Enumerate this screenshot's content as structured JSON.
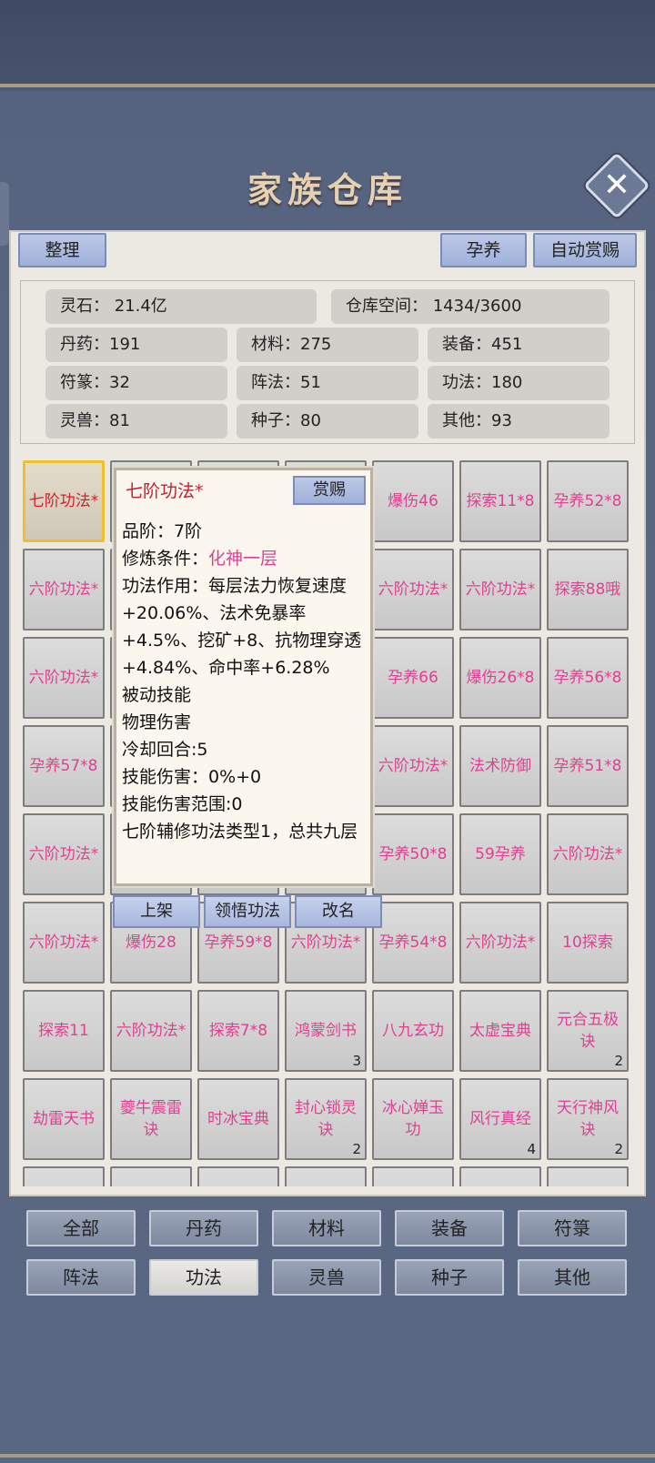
{
  "title": "家族仓库",
  "toolbar": {
    "sort": "整理",
    "nurture": "孕养",
    "auto_reward": "自动赏赐"
  },
  "stats": {
    "spirit_stone": "灵石：  21.4亿",
    "capacity": "仓库空间：   1434/3600",
    "pills": "丹药：191",
    "materials": "材料：275",
    "equipment": "装备：451",
    "talismans": "符篆：32",
    "formations": "阵法：51",
    "techniques": "功法：180",
    "beasts": "灵兽：81",
    "seeds": "种子：80",
    "others": "其他：93"
  },
  "grid": [
    {
      "label": "七阶功法*",
      "selected": true
    },
    {
      "label": ""
    },
    {
      "label": ""
    },
    {
      "label": ""
    },
    {
      "label": "爆伤46"
    },
    {
      "label": "探索11*8"
    },
    {
      "label": "孕养52*8"
    },
    {
      "label": "六阶功法*"
    },
    {
      "label": ""
    },
    {
      "label": ""
    },
    {
      "label": ""
    },
    {
      "label": "六阶功法*"
    },
    {
      "label": "六阶功法*"
    },
    {
      "label": "探索88哦"
    },
    {
      "label": "六阶功法*"
    },
    {
      "label": ""
    },
    {
      "label": ""
    },
    {
      "label": ""
    },
    {
      "label": "孕养66"
    },
    {
      "label": "爆伤26*8"
    },
    {
      "label": "孕养56*8"
    },
    {
      "label": "孕养57*8"
    },
    {
      "label": ""
    },
    {
      "label": ""
    },
    {
      "label": ""
    },
    {
      "label": "六阶功法*"
    },
    {
      "label": "法术防御"
    },
    {
      "label": "孕养51*8"
    },
    {
      "label": "六阶功法*"
    },
    {
      "label": ""
    },
    {
      "label": ""
    },
    {
      "label": ""
    },
    {
      "label": "孕养50*8"
    },
    {
      "label": "59孕养"
    },
    {
      "label": "六阶功法*"
    },
    {
      "label": "六阶功法*"
    },
    {
      "label": "爆伤28"
    },
    {
      "label": "孕养59*8"
    },
    {
      "label": "六阶功法*"
    },
    {
      "label": "孕养54*8"
    },
    {
      "label": "六阶功法*"
    },
    {
      "label": "10探索"
    },
    {
      "label": "探索11"
    },
    {
      "label": "六阶功法*"
    },
    {
      "label": "探索7*8"
    },
    {
      "label": "鸿蒙剑书",
      "count": "3"
    },
    {
      "label": "八九玄功"
    },
    {
      "label": "太虚宝典"
    },
    {
      "label": "元合五极诀",
      "count": "2"
    },
    {
      "label": "劫雷天书"
    },
    {
      "label": "夔牛震雷诀"
    },
    {
      "label": "时冰宝典"
    },
    {
      "label": "封心锁灵诀",
      "count": "2"
    },
    {
      "label": "冰心婵玉功"
    },
    {
      "label": "风行真经",
      "count": "4"
    },
    {
      "label": "天行神风诀",
      "count": "2"
    },
    {
      "label": ""
    },
    {
      "label": ""
    },
    {
      "label": ""
    },
    {
      "label": ""
    },
    {
      "label": ""
    },
    {
      "label": ""
    },
    {
      "label": ""
    }
  ],
  "popup": {
    "title": "七阶功法*",
    "reward_label": "赏赐",
    "grade": "品阶：7阶",
    "req_label": "修炼条件：",
    "req_value": "化神一层",
    "effect": "功法作用：每层法力恢复速度+20.06%、法术免暴率+4.5%、挖矿+8、抗物理穿透+4.84%、命中率+6.28%",
    "passive": "被动技能",
    "damage_type": "物理伤害",
    "cooldown": "冷却回合:5",
    "skill_damage": "技能伤害：0%+0",
    "skill_range": "技能伤害范围:0",
    "aux": "七阶辅修功法类型1，总共九层"
  },
  "actions": {
    "list": "上架",
    "comprehend": "领悟功法",
    "rename": "改名"
  },
  "tabs": [
    {
      "label": "全部"
    },
    {
      "label": "丹药"
    },
    {
      "label": "材料"
    },
    {
      "label": "装备"
    },
    {
      "label": "符箓"
    },
    {
      "label": "阵法"
    },
    {
      "label": "功法",
      "active": true
    },
    {
      "label": "灵兽"
    },
    {
      "label": "种子"
    },
    {
      "label": "其他"
    }
  ]
}
